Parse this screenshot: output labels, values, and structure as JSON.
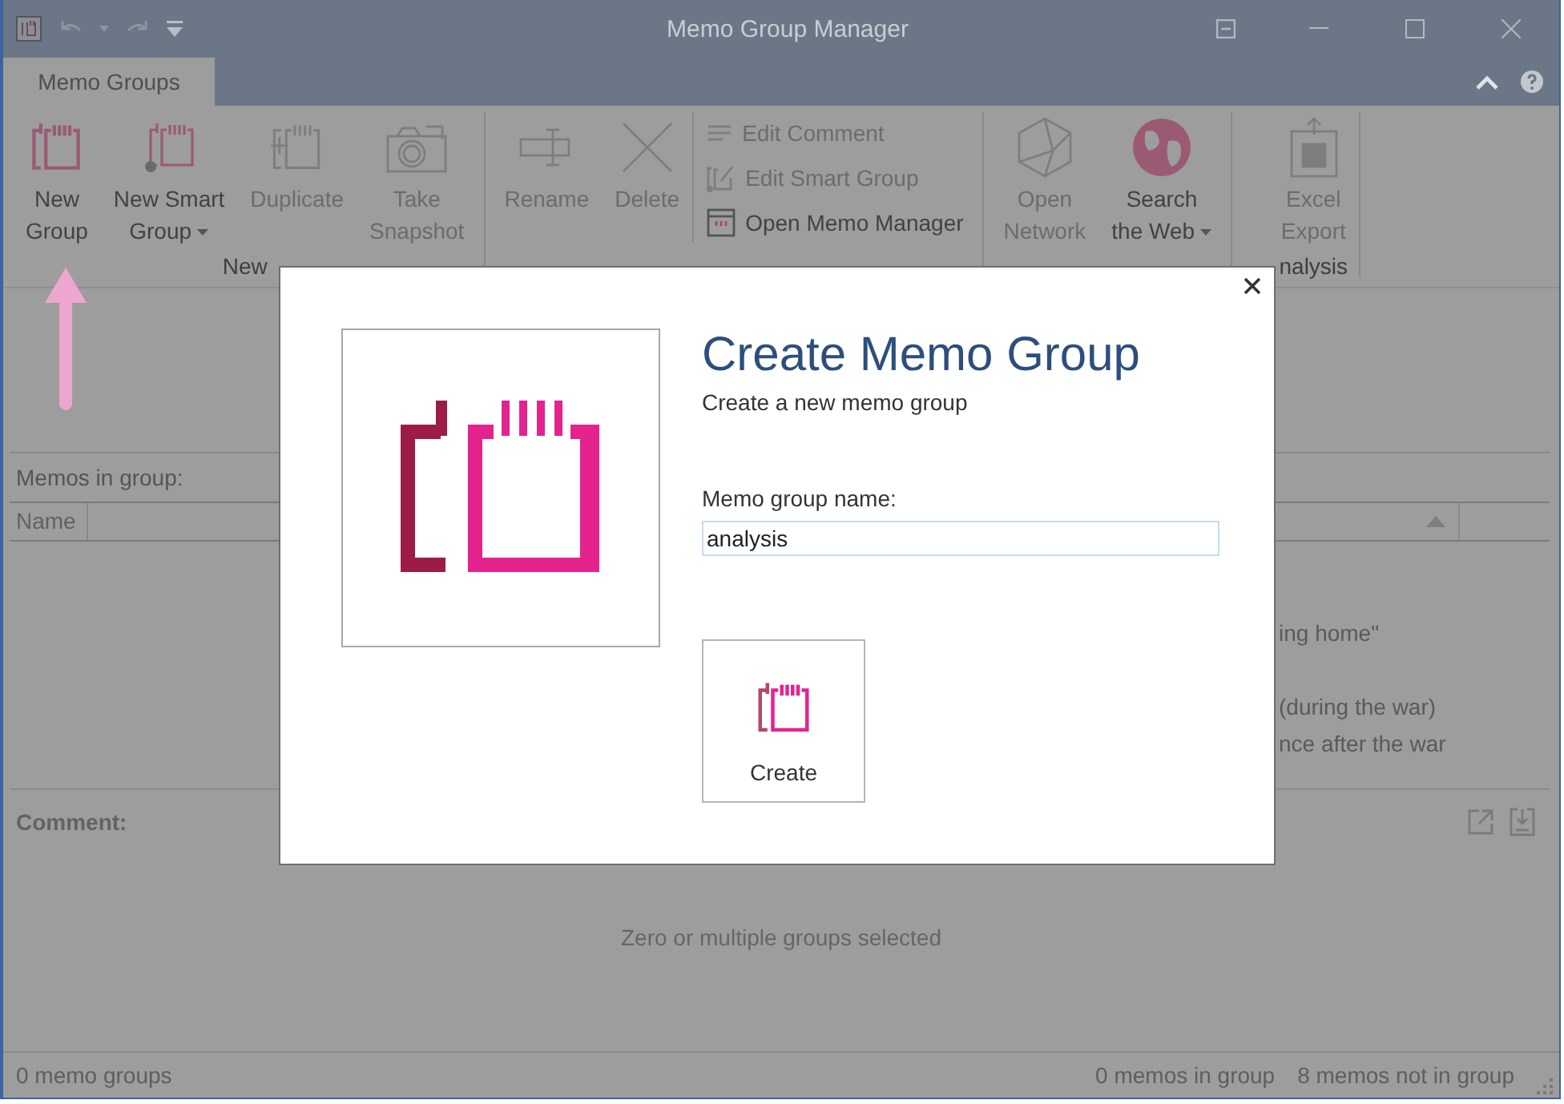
{
  "window": {
    "title": "Memo Group Manager"
  },
  "ribbon": {
    "tabs": [
      {
        "label": "Memo Groups",
        "selected": true
      }
    ],
    "groups": [
      {
        "label": "New",
        "items": [
          {
            "kind": "large",
            "lines": [
              "New",
              "Group"
            ],
            "disabled": false
          },
          {
            "kind": "large",
            "lines": [
              "New Smart",
              "Group"
            ],
            "disabled": false,
            "dropdown": true
          },
          {
            "kind": "large",
            "lines": [
              "Duplicate"
            ],
            "disabled": true
          },
          {
            "kind": "large",
            "lines": [
              "Take",
              "Snapshot"
            ],
            "disabled": true
          }
        ]
      },
      {
        "items": [
          {
            "kind": "large",
            "lines": [
              "Rename"
            ],
            "disabled": true
          },
          {
            "kind": "large",
            "lines": [
              "Delete"
            ],
            "disabled": true
          },
          {
            "kind": "small",
            "lines": [
              "Edit Comment"
            ],
            "disabled": true
          },
          {
            "kind": "small",
            "lines": [
              "Edit Smart Group"
            ],
            "disabled": true
          },
          {
            "kind": "small",
            "lines": [
              "Open Memo Manager"
            ],
            "disabled": false
          }
        ]
      },
      {
        "items": [
          {
            "kind": "large",
            "lines": [
              "Open",
              "Network"
            ],
            "disabled": true
          },
          {
            "kind": "large",
            "lines": [
              "Search",
              "the Web"
            ],
            "disabled": false,
            "dropdown": true
          }
        ]
      },
      {
        "label": "nalysis",
        "items": [
          {
            "kind": "large",
            "lines": [
              "Excel",
              "Export"
            ],
            "disabled": true
          }
        ]
      }
    ]
  },
  "memos_panel": {
    "title": "Memos in group:",
    "columns": [
      "Name"
    ],
    "rows": [
      "ing home\"",
      "(during the war)",
      "nce after the war"
    ]
  },
  "comment": {
    "label": "Comment:",
    "empty_text": "Zero or multiple groups selected"
  },
  "status_bar": {
    "left": "0 memo groups",
    "right": [
      "0 memos in group",
      "8 memos not in group"
    ]
  },
  "dialog": {
    "title": "Create Memo Group",
    "subtitle": "Create a new memo group",
    "field_label": "Memo group name:",
    "value": "analysis",
    "button": "Create"
  }
}
